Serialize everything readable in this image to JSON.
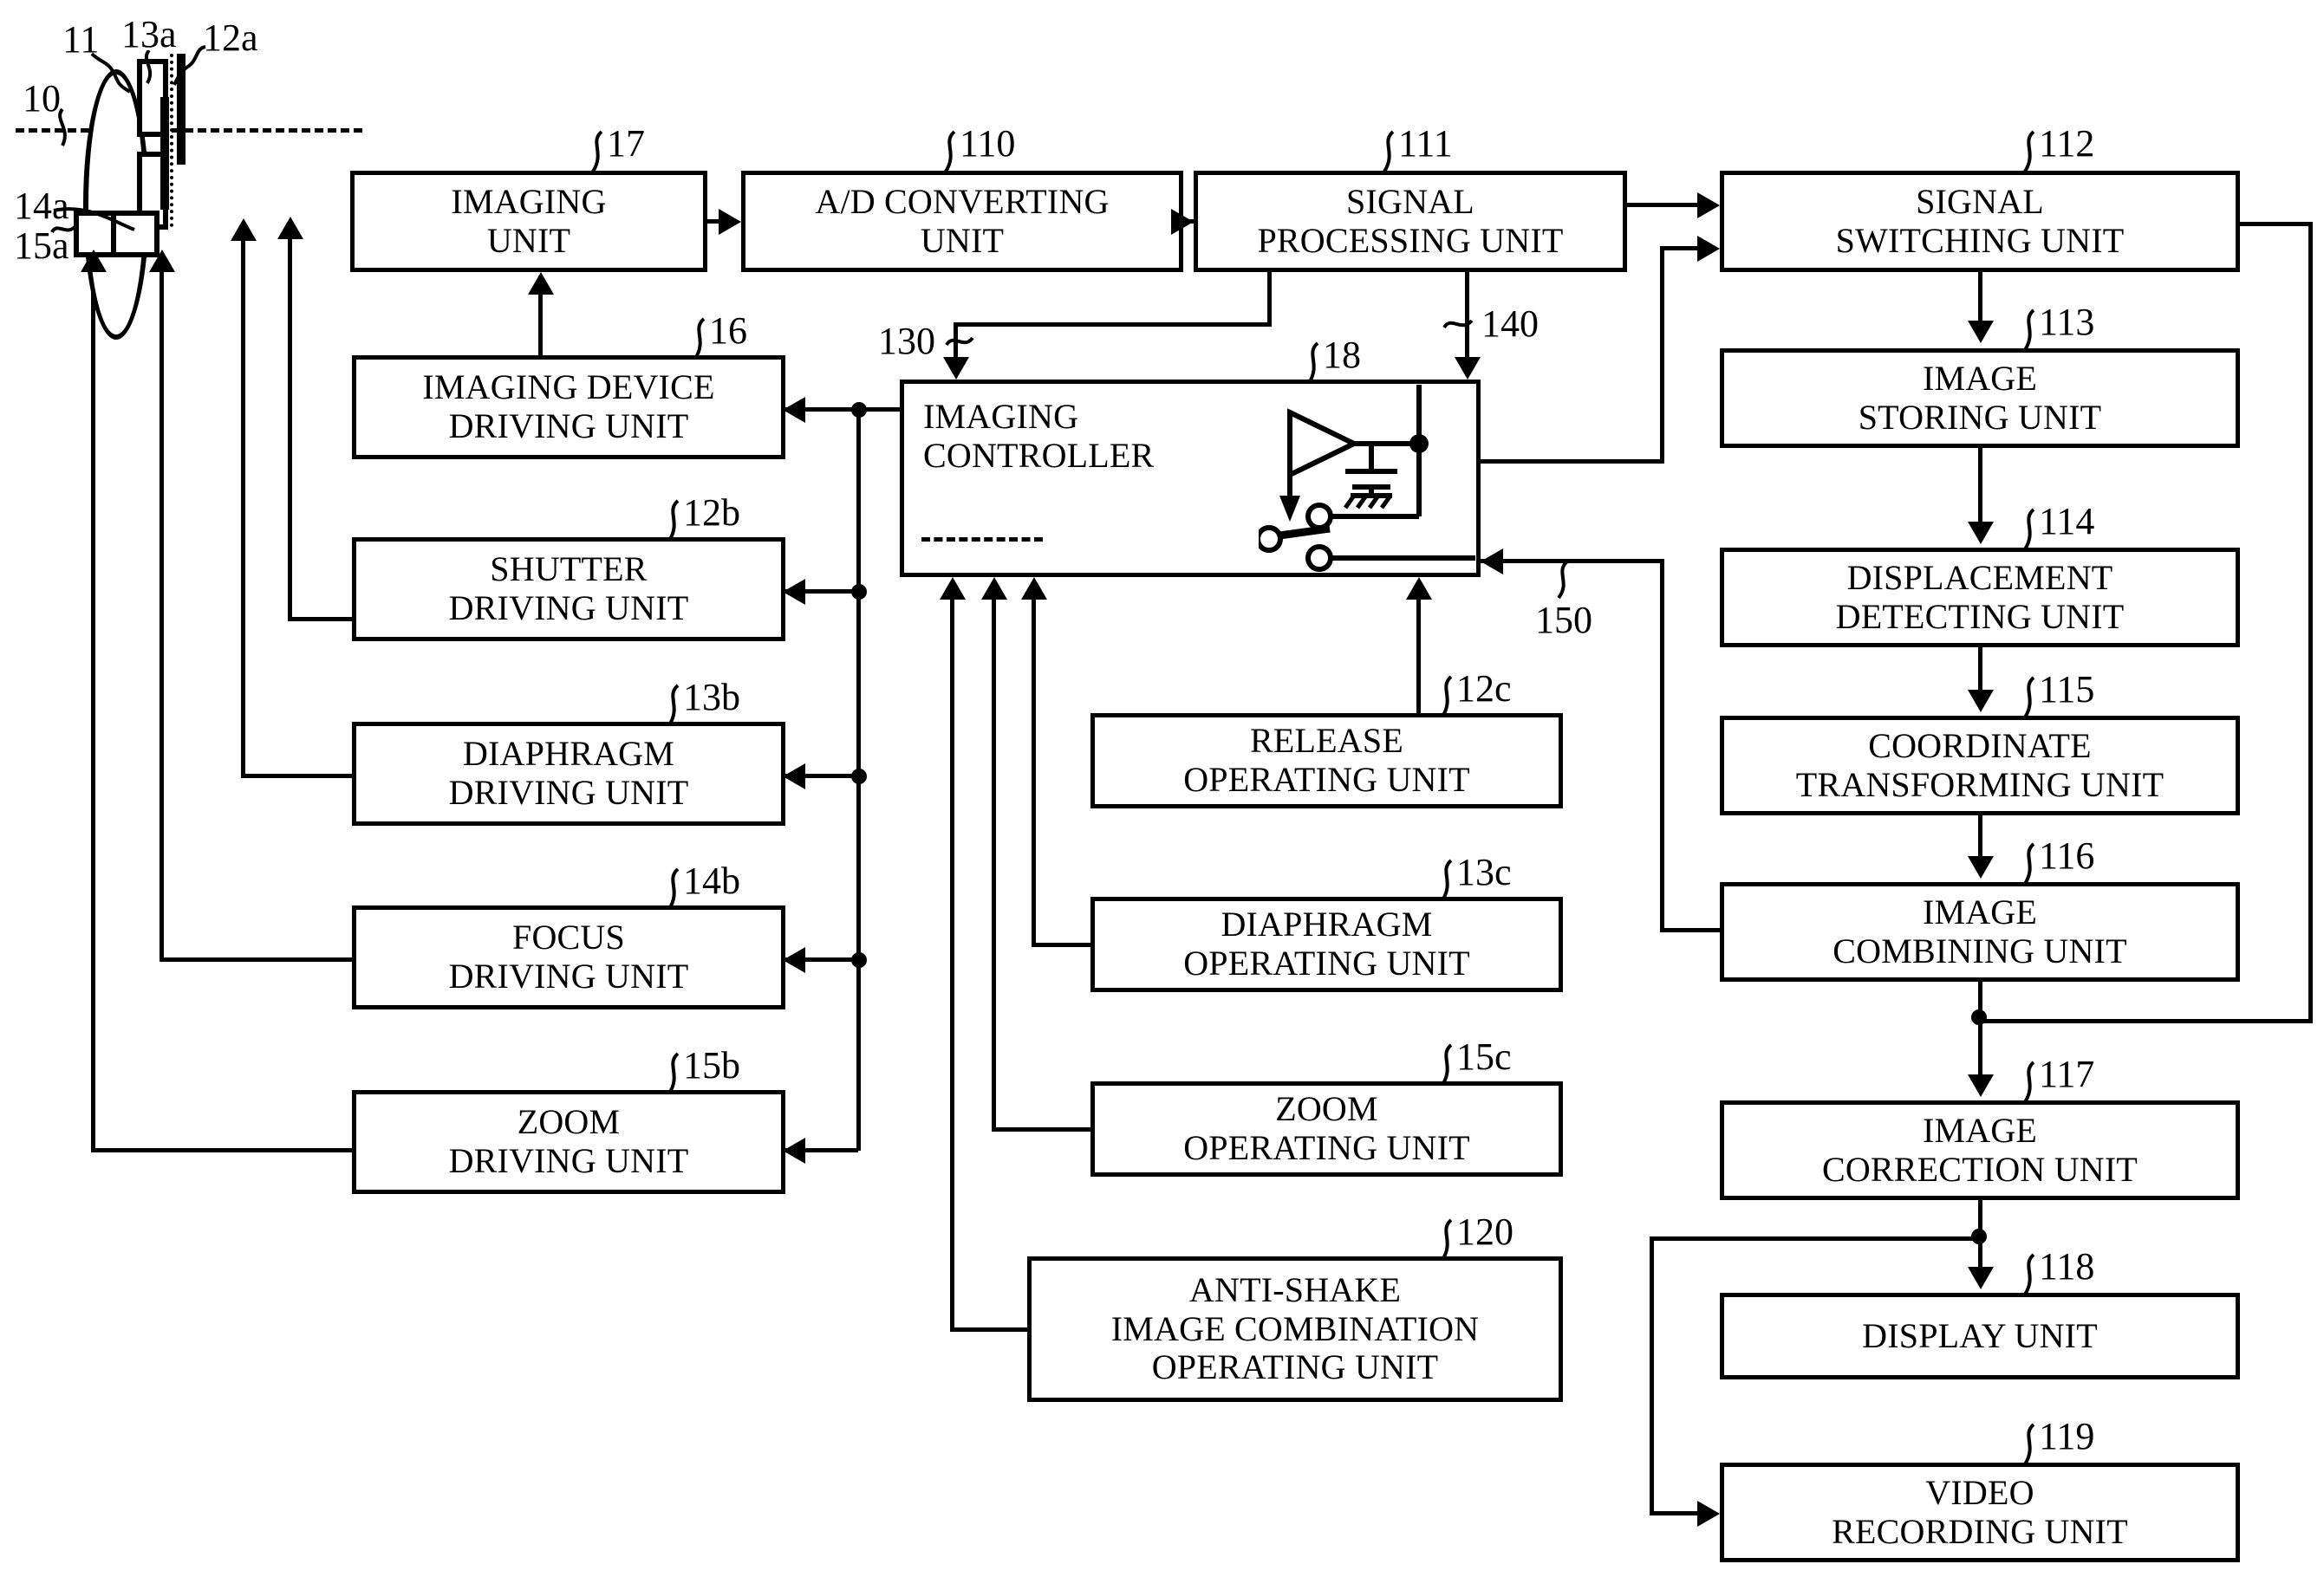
{
  "figure": {
    "type": "patent-block-diagram",
    "title": "Imaging apparatus block diagram"
  },
  "optics": {
    "axis_label": "10",
    "lens_label": "11",
    "element_13a": "13a",
    "element_12a": "12a",
    "element_14a": "14a",
    "element_15a": "15a"
  },
  "blocks": [
    {
      "id": "imaging-unit",
      "ref": "17",
      "label": "IMAGING\nUNIT"
    },
    {
      "id": "ad-converting-unit",
      "ref": "110",
      "label": "A/D CONVERTING\nUNIT"
    },
    {
      "id": "signal-processing-unit",
      "ref": "111",
      "label": "SIGNAL\nPROCESSING UNIT"
    },
    {
      "id": "signal-switching-unit",
      "ref": "112",
      "label": "SIGNAL\nSWITCHING UNIT"
    },
    {
      "id": "image-storing-unit",
      "ref": "113",
      "label": "IMAGE\nSTORING UNIT"
    },
    {
      "id": "displacement-detecting-unit",
      "ref": "114",
      "label": "DISPLACEMENT\nDETECTING UNIT"
    },
    {
      "id": "coordinate-transforming-unit",
      "ref": "115",
      "label": "COORDINATE\nTRANSFORMING UNIT"
    },
    {
      "id": "image-combining-unit",
      "ref": "116",
      "label": "IMAGE\nCOMBINING UNIT"
    },
    {
      "id": "image-correction-unit",
      "ref": "117",
      "label": "IMAGE\nCORRECTION UNIT"
    },
    {
      "id": "display-unit",
      "ref": "118",
      "label": "DISPLAY UNIT"
    },
    {
      "id": "video-recording-unit",
      "ref": "119",
      "label": "VIDEO\nRECORDING UNIT"
    },
    {
      "id": "imaging-device-driving-unit",
      "ref": "16",
      "label": "IMAGING DEVICE\nDRIVING UNIT"
    },
    {
      "id": "shutter-driving-unit",
      "ref": "12b",
      "label": "SHUTTER\nDRIVING UNIT"
    },
    {
      "id": "diaphragm-driving-unit",
      "ref": "13b",
      "label": "DIAPHRAGM\nDRIVING UNIT"
    },
    {
      "id": "focus-driving-unit",
      "ref": "14b",
      "label": "FOCUS\nDRIVING UNIT"
    },
    {
      "id": "zoom-driving-unit",
      "ref": "15b",
      "label": "ZOOM\nDRIVING UNIT"
    },
    {
      "id": "imaging-controller",
      "ref": "18",
      "label": "IMAGING\nCONTROLLER"
    },
    {
      "id": "release-operating-unit",
      "ref": "12c",
      "label": "RELEASE\nOPERATING UNIT"
    },
    {
      "id": "diaphragm-operating-unit",
      "ref": "13c",
      "label": "DIAPHRAGM\nOPERATING UNIT"
    },
    {
      "id": "zoom-operating-unit",
      "ref": "15c",
      "label": "ZOOM\nOPERATING UNIT"
    },
    {
      "id": "anti-shake-image-combination-operating-unit",
      "ref": "120",
      "label": "ANTI-SHAKE\nIMAGE COMBINATION\nOPERATING UNIT"
    }
  ],
  "signal_labels": {
    "s130": "130",
    "s140": "140",
    "s150": "150"
  },
  "colors": {
    "line": "#000000",
    "background": "#ffffff"
  }
}
